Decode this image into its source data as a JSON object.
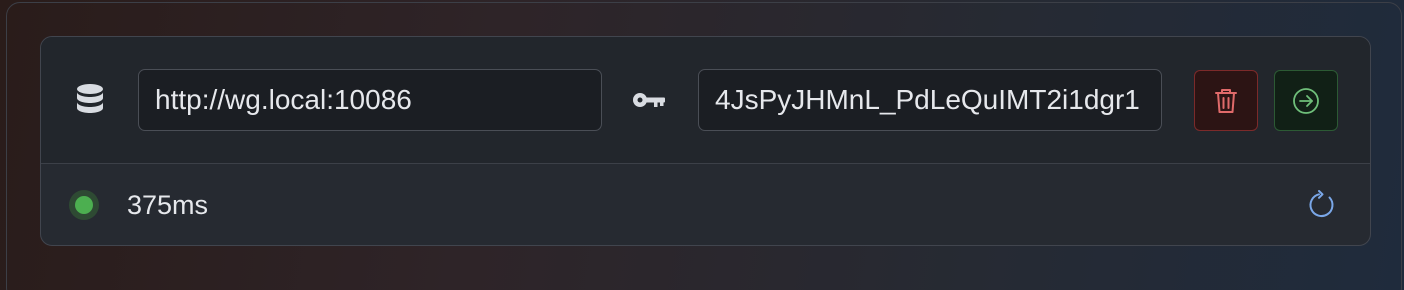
{
  "server": {
    "url": "http://wg.local:10086",
    "api_key": "4JsPyJHMnL_PdLeQuIMT2i1dgr1"
  },
  "status": {
    "latency": "375ms",
    "color": "#4caf50"
  },
  "icons": {
    "server": "database-icon",
    "key": "key-icon",
    "delete": "trash-icon",
    "connect": "arrow-right-circle-icon",
    "refresh": "refresh-icon"
  },
  "colors": {
    "delete_accent": "#e06a6a",
    "connect_accent": "#6fbf7a",
    "refresh_accent": "#7aa7e8"
  }
}
